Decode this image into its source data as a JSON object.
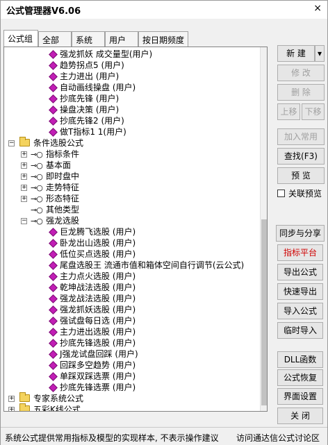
{
  "window": {
    "title": "公式管理器V6.06",
    "close_glyph": "×"
  },
  "tabs": [
    "公式组",
    "全部",
    "系统",
    "用户",
    "按日期频度"
  ],
  "tree": [
    {
      "text": "强龙抓妖   成交量型(用户)",
      "icon": "gem"
    },
    {
      "text": "趋势拐点5  (用户)",
      "icon": "gem"
    },
    {
      "text": "主力进出  (用户)",
      "icon": "gem"
    },
    {
      "text": "自动画线操盘  (用户)",
      "icon": "gem"
    },
    {
      "text": "抄底先锋  (用户)",
      "icon": "gem"
    },
    {
      "text": "操盘决策  (用户)",
      "icon": "gem"
    },
    {
      "text": "抄底先锋2  (用户)",
      "icon": "gem"
    },
    {
      "text": "做T指标1  1(用户)",
      "icon": "gem"
    },
    {
      "text": "条件选股公式",
      "icon": "folder"
    },
    {
      "text": "指标条件",
      "icon": "key"
    },
    {
      "text": "基本面",
      "icon": "key"
    },
    {
      "text": "即时盘中",
      "icon": "key"
    },
    {
      "text": "走势特征",
      "icon": "key"
    },
    {
      "text": "形态特征",
      "icon": "key"
    },
    {
      "text": "其他类型",
      "icon": "key"
    },
    {
      "text": "强龙选股",
      "icon": "key"
    },
    {
      "text": "巨龙腾飞选股  (用户)",
      "icon": "gem"
    },
    {
      "text": "卧龙出山选股  (用户)",
      "icon": "gem"
    },
    {
      "text": "低位买点选股  (用户)",
      "icon": "gem"
    },
    {
      "text": "尾盘选股王   流通市值和箱体空间自行调节(云公式)",
      "icon": "gem"
    },
    {
      "text": "主力点火选股  (用户)",
      "icon": "gem"
    },
    {
      "text": "乾坤战法选股  (用户)",
      "icon": "gem"
    },
    {
      "text": "强龙战法选股  (用户)",
      "icon": "gem"
    },
    {
      "text": "强龙抓妖选股  (用户)",
      "icon": "gem"
    },
    {
      "text": "强试盘每日选  (用户)",
      "icon": "gem"
    },
    {
      "text": "主力进出选股  (用户)",
      "icon": "gem"
    },
    {
      "text": "抄底先锋选股  (用户)",
      "icon": "gem"
    },
    {
      "text": "J强龙试盘回踩  (用户)",
      "icon": "gem"
    },
    {
      "text": "回踩多空趋势  (用户)",
      "icon": "gem"
    },
    {
      "text": "单踩双踩选票  (用户)",
      "icon": "gem"
    },
    {
      "text": "抄底先锋选票  (用户)",
      "icon": "gem"
    },
    {
      "text": "专家系统公式",
      "icon": "folder"
    },
    {
      "text": "五彩K线公式",
      "icon": "folder"
    }
  ],
  "buttons": {
    "new": "新  建",
    "new_arrow": "▾",
    "edit": "修  改",
    "delete": "删  除",
    "move_up": "上移",
    "move_down": "下移",
    "add_common": "加入常用",
    "find": "查找(F3)",
    "preview": "预  览",
    "link_preview": "关联预览",
    "sync_share": "同步与分享",
    "indicator_platform": "指标平台",
    "export_formula": "导出公式",
    "quick_export": "快速导出",
    "import_formula": "导入公式",
    "temp_import": "临时导入",
    "dll": "DLL函数",
    "restore": "公式恢复",
    "ui_settings": "界面设置",
    "close": "关  闭"
  },
  "status": {
    "left": "系统公式提供常用指标及模型的实现样本, 不表示操作建议",
    "right": "访问通达信公式讨论区"
  },
  "colors": {
    "gem": "#c11eb5",
    "folder": "#f4d35e",
    "red_button": "#d00000"
  }
}
